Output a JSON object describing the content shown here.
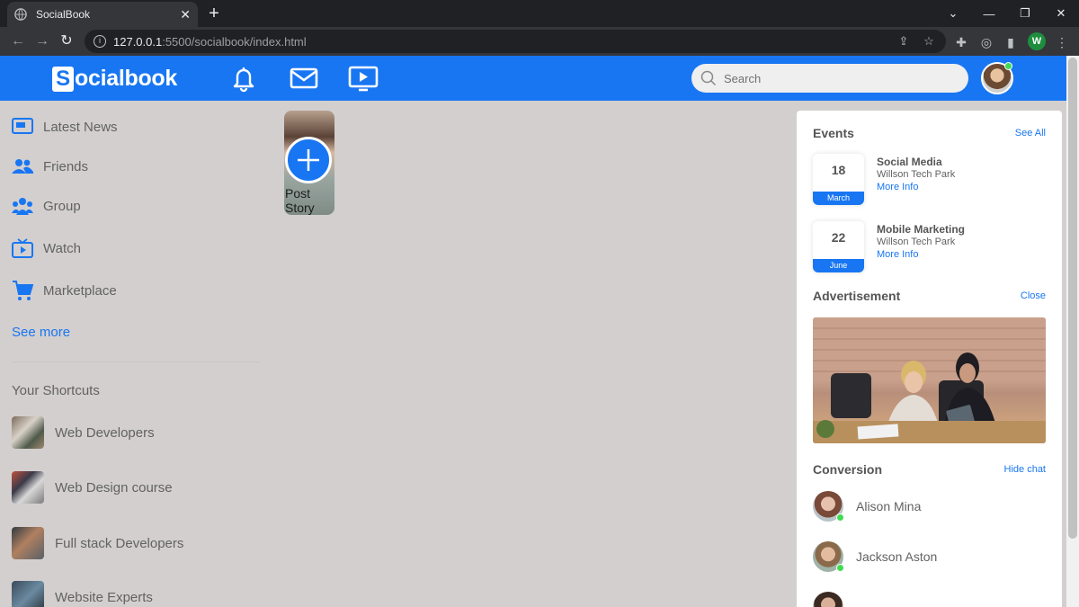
{
  "browser": {
    "tab_title": "SocialBook",
    "url_host": "127.0.0.1",
    "url_rest": ":5500/socialbook/index.html",
    "profile_initial": "W"
  },
  "header": {
    "logo_letter": "S",
    "logo_rest": "ocialbook",
    "search_placeholder": "Search"
  },
  "sidebar": {
    "items": [
      {
        "label": "Latest News",
        "icon": "news-icon"
      },
      {
        "label": "Friends",
        "icon": "friends-icon"
      },
      {
        "label": "Group",
        "icon": "group-icon"
      },
      {
        "label": "Watch",
        "icon": "watch-icon"
      },
      {
        "label": "Marketplace",
        "icon": "cart-icon"
      }
    ],
    "see_more": "See more",
    "shortcuts_title": "Your Shortcuts",
    "shortcuts": [
      {
        "label": "Web Developers"
      },
      {
        "label": "Web Design course"
      },
      {
        "label": "Full stack Developers"
      },
      {
        "label": "Website Experts"
      }
    ]
  },
  "story": {
    "label": "Post Story"
  },
  "right": {
    "events_title": "Events",
    "events_link": "See All",
    "events": [
      {
        "day": "18",
        "month": "March",
        "name": "Social Media",
        "location": "Willson Tech Park",
        "more": "More Info"
      },
      {
        "day": "22",
        "month": "June",
        "name": "Mobile Marketing",
        "location": "Willson Tech Park",
        "more": "More Info"
      }
    ],
    "ad_title": "Advertisement",
    "ad_link": "Close",
    "chat_title": "Conversion",
    "chat_link": "Hide chat",
    "contacts": [
      {
        "name": "Alison Mina"
      },
      {
        "name": "Jackson Aston"
      }
    ]
  },
  "colors": {
    "brand": "#1876f2",
    "background": "#d3cfcf",
    "online": "#41db51"
  }
}
